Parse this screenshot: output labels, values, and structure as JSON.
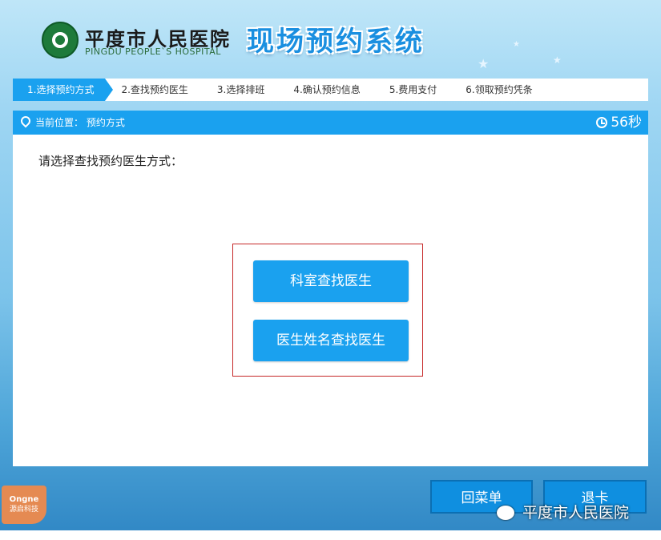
{
  "header": {
    "hospital_name_cn": "平度市人民医院",
    "hospital_name_en": "PINGDU PEOPLE`S HOSPITAL",
    "system_title": "现场预约系统"
  },
  "steps": [
    {
      "label": "1.选择预约方式",
      "active": true
    },
    {
      "label": "2.查找预约医生",
      "active": false
    },
    {
      "label": "3.选择排班",
      "active": false
    },
    {
      "label": "4.确认预约信息",
      "active": false
    },
    {
      "label": "5.费用支付",
      "active": false
    },
    {
      "label": "6.领取预约凭条",
      "active": false
    }
  ],
  "panel": {
    "location": "当前位置： 预约方式",
    "timer": "56秒",
    "prompt": "请选择查找预约医生方式：",
    "option_department": "科室查找医生",
    "option_doctor_name": "医生姓名查找医生"
  },
  "footer": {
    "menu_button": "回菜单",
    "exit_button": "退卡",
    "brand_line1": "Ongne",
    "brand_line2": "源启科技",
    "watermark": "平度市人民医院"
  },
  "colors": {
    "accent": "#1aa1ef",
    "highlight_border": "#c62828"
  }
}
